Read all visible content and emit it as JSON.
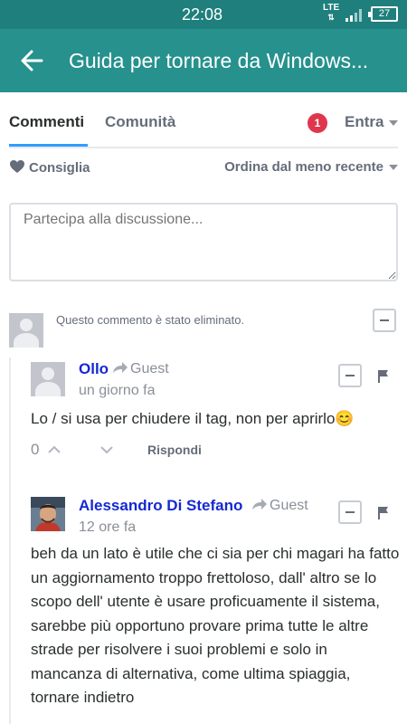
{
  "status": {
    "time": "22:08",
    "network": "LTE",
    "battery": "27"
  },
  "appbar": {
    "title": "Guida per tornare da Windows..."
  },
  "tabs": {
    "comments": "Commenti",
    "community": "Comunità",
    "notifications": "1",
    "login": "Entra"
  },
  "toolbar": {
    "recommend": "Consiglia",
    "sort": "Ordina dal meno recente"
  },
  "composer": {
    "placeholder": "Partecipa alla discussione..."
  },
  "deleted_comment": {
    "text": "Questo commento è stato eliminato."
  },
  "comments": [
    {
      "author": "Ollo",
      "guest": "Guest",
      "time": "un giorno fa",
      "body": "Lo / si usa per chiudere il tag, non per aprirlo😊",
      "votes": "0",
      "reply": "Rispondi"
    },
    {
      "author": "Alessandro Di Stefano",
      "guest": "Guest",
      "time": "12 ore fa",
      "body": "beh da un lato è utile che ci sia per chi magari ha fatto un aggiornamento troppo frettoloso, dall' altro se lo scopo dell' utente è usare proficuamente il sistema, sarebbe più opportuno provare prima tutte le altre strade per risolvere i suoi problemi e solo in mancanza di alternativa, come ultima spiaggia, tornare indietro"
    }
  ],
  "colors": {
    "appbar": "#26918d",
    "statusbar": "#1f7f7c",
    "author_link": "#1528d4",
    "active_tab": "#2e9fff",
    "badge": "#e0364d"
  },
  "icons": [
    "back-arrow-icon",
    "heart-icon",
    "share-arrow-icon",
    "flag-icon",
    "chevron-up-icon",
    "chevron-down-icon",
    "minus-icon"
  ]
}
